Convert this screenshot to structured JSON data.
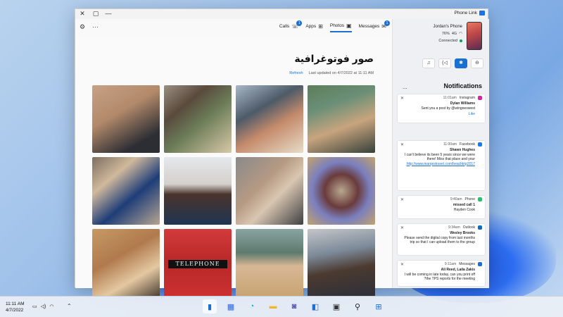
{
  "app": {
    "title": "Phone Link",
    "window_controls": {
      "close": "✕",
      "maximize": "▢",
      "minimize": "—"
    }
  },
  "toolbar": {
    "settings_icon": "gear-icon",
    "more_icon": "more-icon",
    "tabs": [
      {
        "label": "Messages",
        "icon": "message-icon",
        "badge": "1",
        "active": false
      },
      {
        "label": "Photos",
        "icon": "photo-icon",
        "badge": "",
        "active": true
      },
      {
        "label": "Apps",
        "icon": "apps-icon",
        "badge": "",
        "active": false
      },
      {
        "label": "Calls",
        "icon": "phone-icon",
        "badge": "1",
        "active": false
      }
    ]
  },
  "photos": {
    "title": "صور فوتوغرافية",
    "last_updated": "Last updated on 4/7/2022 at 11:11 AM",
    "refresh_label": "Refresh",
    "telephone_sign": "TELEPHONE"
  },
  "device": {
    "name": "Jordan's Phone",
    "signal": "4G",
    "battery": "76%",
    "status": "Connected"
  },
  "quick_actions": [
    {
      "icon": "do-not-disturb-icon",
      "active": false
    },
    {
      "icon": "bluetooth-icon",
      "active": true
    },
    {
      "icon": "volume-icon",
      "active": false
    },
    {
      "icon": "music-icon",
      "active": false
    }
  ],
  "notifications": {
    "header": "Notifications",
    "more": "...",
    "items": [
      {
        "app": "Instagram",
        "time": "11:01am",
        "title": "Dylan Williams",
        "body": "Sent you a post by @wingoeswest",
        "action": "Like",
        "color": "#d6249f"
      },
      {
        "app": "Facebook",
        "time": "11:00am",
        "title": "Shawn Hughes",
        "body": "I can't believe its been 5 years since we were there! Miss that place and your",
        "link": "http://www.marqestravel.com/beachtrip2017",
        "color": "#1877f2"
      },
      {
        "app": "Phone",
        "time": "9:40am",
        "title": "1 missed call",
        "body": "Hayden Cook",
        "color": "#25c26e"
      },
      {
        "app": "Outlook",
        "time": "9:34am",
        "title": "Wesley Brooks",
        "body": "Please send the digital copy from last months trip so that I can upload them to the group",
        "color": "#0f6cbd"
      },
      {
        "app": "Messages",
        "time": "9:11am",
        "title": "Ali Reed, Laila Zakis",
        "body": "I will be coming in late today, can you print off the TPS reports for the meeting?",
        "color": "#1a6fd1"
      }
    ]
  },
  "taskbar": {
    "time": "11:11 AM",
    "date": "4/7/2022",
    "apps": [
      "phonelink-icon",
      "store-icon",
      "edge-icon",
      "explorer-icon",
      "teams-icon",
      "widgets-icon",
      "taskview-icon",
      "search-icon",
      "start-icon"
    ]
  }
}
